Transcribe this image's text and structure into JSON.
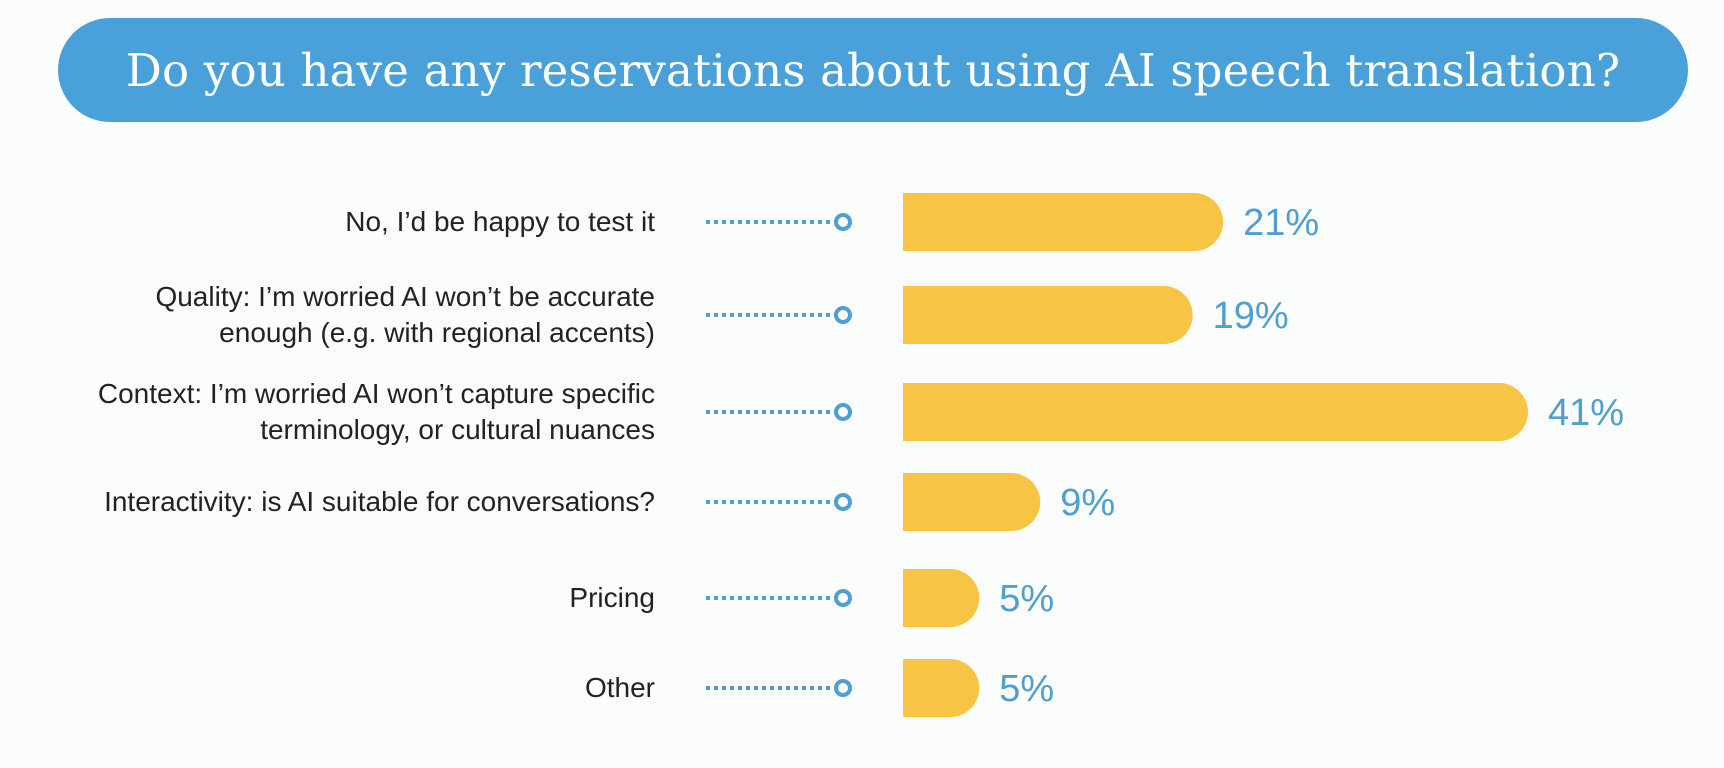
{
  "colors": {
    "title_bg": "#4aa1d9",
    "bar": "#f7c443",
    "connector": "#4f9fd0",
    "value_text": "#4f9fd0",
    "label_text": "#222222"
  },
  "chart_data": {
    "type": "bar",
    "orientation": "horizontal",
    "title": "Do you have any reservations about using AI speech translation?",
    "categories": [
      [
        "No, I’d be happy to test it"
      ],
      [
        "Quality: I’m worried AI won’t be accurate",
        "enough (e.g. with regional accents)"
      ],
      [
        "Context: I’m worried AI won’t capture specific",
        "terminology, or cultural nuances"
      ],
      [
        "Interactivity: is AI suitable for conversations?"
      ],
      [
        "Pricing"
      ],
      [
        "Other"
      ]
    ],
    "values": [
      21,
      19,
      41,
      9,
      5,
      5
    ],
    "value_labels": [
      "21%",
      "19%",
      "41%",
      "9%",
      "5%",
      "5%"
    ],
    "unit": "%",
    "xlim": [
      0,
      41
    ],
    "grid": false,
    "legend": "none"
  }
}
